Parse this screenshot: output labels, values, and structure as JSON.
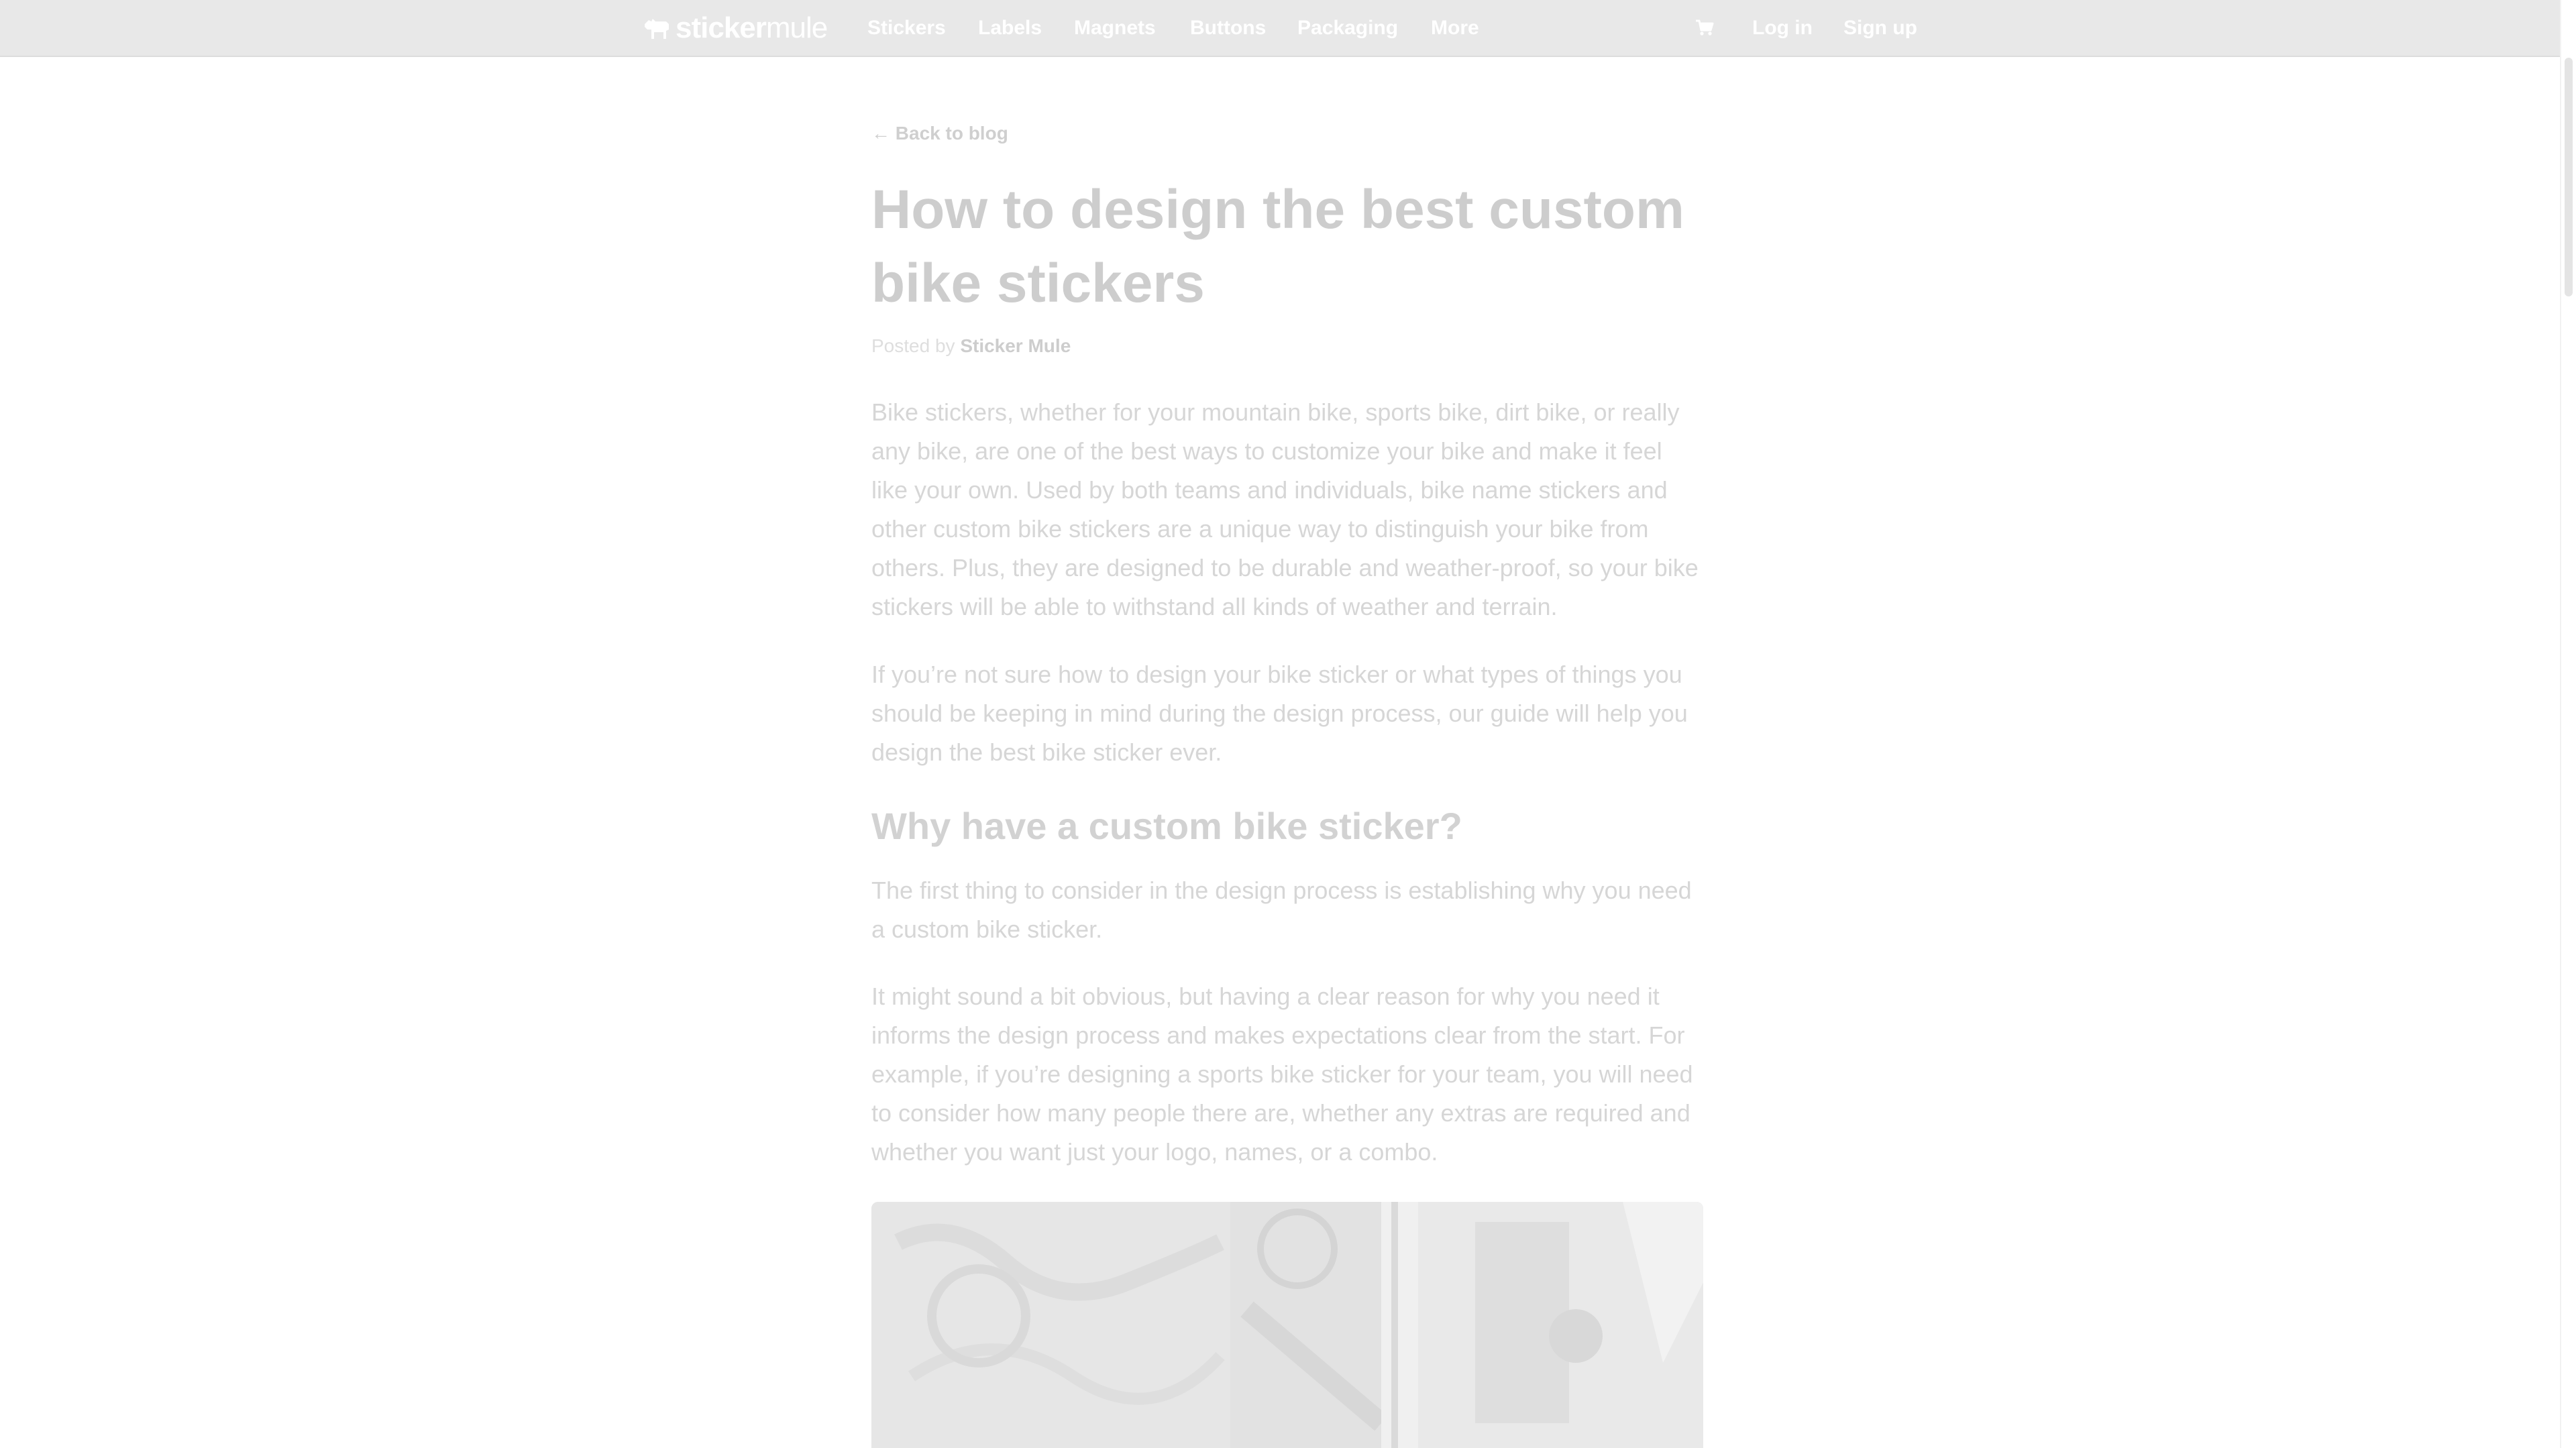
{
  "nav": {
    "logo_bold": "sticker",
    "logo_light": "mule",
    "links": [
      "Stickers",
      "Labels",
      "Magnets",
      "Buttons",
      "Packaging",
      "More"
    ],
    "login": "Log in",
    "signup": "Sign up",
    "cart_icon": "cart-icon"
  },
  "article": {
    "back_link": "← Back to blog",
    "title": "How to design the best custom bike stickers",
    "byline_prefix": "Posted by ",
    "author": "Sticker Mule",
    "paragraphs": [
      "Bike stickers, whether for your mountain bike, sports bike, dirt bike, or really any bike, are one of the best ways to customize your bike and make it feel like your own. Used by both teams and individuals, bike name stickers and other custom bike stickers are a unique way to distinguish your bike from others. Plus, they are designed to be durable and weather-proof, so your bike stickers will be able to withstand all kinds of weather and terrain.",
      "If you’re not sure how to design your bike sticker or what types of things you should be keeping in mind during the design process, our guide will help you design the best bike sticker ever.",
      "The first thing to consider in the design process is establishing why you need a custom bike sticker.",
      "It might sound a bit obvious, but having a clear reason for why you need it informs the design process and makes expectations clear from the start. For example, if you’re designing a sports bike sticker for your team, you will need to consider how many people there are, whether any extras are required and whether you want just your logo, names, or a combo."
    ],
    "subheading": "Why have a custom bike sticker?"
  },
  "colors": {
    "navbar_bg": "#e8e8e8",
    "nav_text": "#ffffff",
    "body_text": "#d6d6d6",
    "heading_text": "#cdcdcd"
  }
}
